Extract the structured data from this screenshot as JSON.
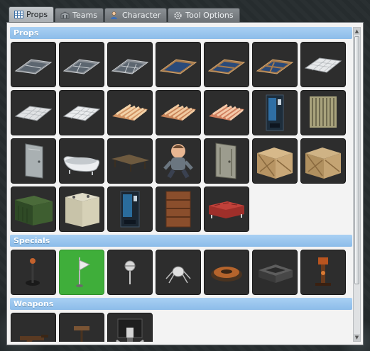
{
  "tabs": [
    {
      "label": "Props",
      "icon": "grid-icon",
      "active": true
    },
    {
      "label": "Teams",
      "icon": "building-icon",
      "active": false
    },
    {
      "label": "Character",
      "icon": "person-icon",
      "active": false
    },
    {
      "label": "Tool Options",
      "icon": "gear-icon",
      "active": false
    }
  ],
  "sections": {
    "props": {
      "title": "Props",
      "items": [
        "glass-floor-panel",
        "glass-floor-panel-2",
        "glass-floor-panel-3",
        "window-pane-2",
        "window-pane-2b",
        "window-pane-4",
        "tile-floor-panel",
        "tile-floor-panel-2",
        "tile-floor-panel-3",
        "wooden-pallet",
        "wooden-pallet-2",
        "wooden-pallet-3",
        "vending-machine",
        "radiator",
        "metal-door",
        "bathtub",
        "wooden-bench",
        "teddy-doll",
        "metal-door-2",
        "wooden-crate",
        "wooden-crate-2",
        "dumpster",
        "metal-cabinet",
        "vending-machine-2",
        "bookshelf",
        "red-couch"
      ]
    },
    "specials": {
      "title": "Specials",
      "items": [
        "joystick",
        "flag-marker",
        "ceiling-lamp",
        "spider-bot",
        "round-landmine",
        "metal-tray",
        "turret-stand"
      ]
    },
    "weapons": {
      "title": "Weapons",
      "items": [
        "gun",
        "stand-turret",
        "mounted-gun"
      ]
    }
  },
  "selected_item": "flag-marker",
  "colors": {
    "section_header": "#9ac6ef",
    "selected_tile": "#3fae3a",
    "tile_bg": "#2d2d2d"
  }
}
